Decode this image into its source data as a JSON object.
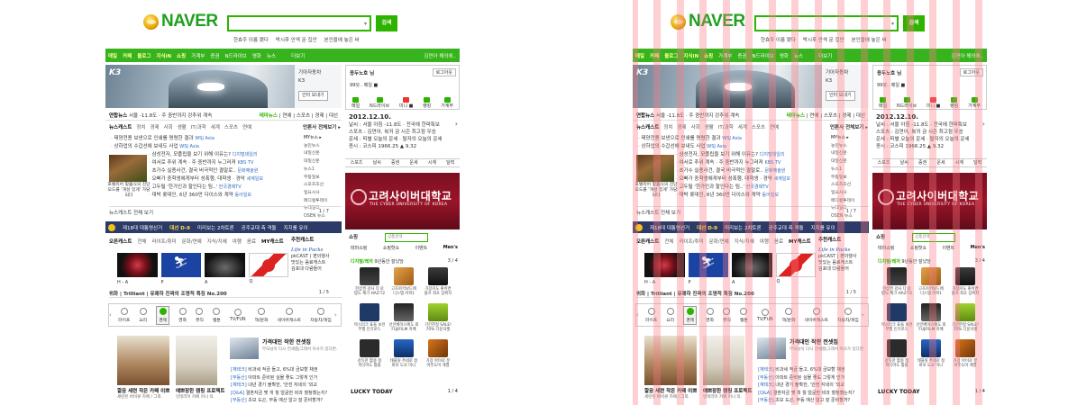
{
  "portal": {
    "logo_text": "NAVER",
    "search": {
      "placeholder": "",
      "button": "검색",
      "dropdown": "▾"
    },
    "hot_keywords": [
      "한효주 이름 됐다",
      "박시후 안색 문 집안",
      "본인을에 놓은 싸"
    ],
    "gnb": {
      "items": [
        "메일",
        "카페",
        "블로그",
        "지식iN",
        "쇼핑",
        "가계부",
        "증권",
        "N드라이브",
        "영화",
        "뉴스"
      ],
      "highlight": [
        "메일",
        "카페",
        "블로그",
        "지식iN",
        "쇼핑"
      ],
      "more": "더보기",
      "right": "김연아 해외에.."
    },
    "banner": {
      "brand": "K3",
      "info_title": "기아자동차",
      "info_sub": "K3",
      "button": "인터 보내기"
    },
    "login": {
      "name": "용두노호 님",
      "logout": "로그아웃",
      "mail": "99닷.. 메일 ■",
      "icons": [
        {
          "label": "메일",
          "count": "",
          "red": false
        },
        {
          "label": "N드라이브",
          "count": "",
          "red": false
        },
        {
          "label": "미니 ■",
          "count": "",
          "red": true
        },
        {
          "label": "랭킹",
          "count": "",
          "red": false
        },
        {
          "label": "가계부",
          "count": "",
          "red": false
        }
      ]
    },
    "breaking": {
      "label": "연합뉴스",
      "text": "서울 -11.8도 · 주 중반까지 강추위 계속",
      "topics": [
        "테마뉴스",
        "연예",
        "스포츠",
        "경제",
        "대선"
      ]
    },
    "date_box": {
      "date": "2012.12.10.",
      "lines": [
        "날씨 : 서울 아침 -11.8도 · 전국에 한파특보",
        "스포츠 : 김연아, 복귀 금 시즌 최고점 우승",
        "운세 : 띠별 오늘의 운세 · 탈자의 오늘의 운세",
        "증시 : 코스피 1966.25 ▲ 9.32"
      ]
    },
    "news_tabs": [
      "뉴스캐스트",
      "정치",
      "경제",
      "사회",
      "생활",
      "IT/과학",
      "세계",
      "스포츠",
      "연예"
    ],
    "news_items": [
      {
        "text": "태양전용 보낸으로 인쇄를 명령한 결과",
        "src": "WSJ Asia"
      },
      {
        "text": "상하업의 수갑선에 보내도 사업",
        "src": "WSJ Asia"
      },
      {
        "text": "삼성전자, 모플립을 보기 위해 이유는?",
        "src": "디지털데일리"
      },
      {
        "text": "여서로 추위 계속 · 주 중반까지 누그러져",
        "src": "KBS TV"
      },
      {
        "text": "초가수 실종사건, 결국 비극적인 결말로..",
        "src": "문화예술원"
      },
      {
        "text": "오빠가 중학생에게부터 성폭행, 대학생 · 경악",
        "src": "세계일보"
      },
      {
        "text": "고두릴 '한가인과 할인다는 팀..'",
        "src": "한국경제TV"
      },
      {
        "text": "대박 롯데인, 6년 360만 다이스와 계약",
        "src": "동아일보"
      }
    ],
    "news_photo_caption": "호텔리어 맞춤식의 진단 모드를 '개성 있게' 가당 되다",
    "press": {
      "label": "언론사 전체보기 ▸",
      "selector": "MY뉴스 ▸",
      "list": [
        "농민뉴스",
        "내일신문",
        "대일신문",
        "뉴스1",
        "무등일보",
        "스포츠조선",
        "일요시사",
        "메디컬투데이",
        "뉴데일리",
        "OSEN 뉴스",
        "WSJ Asia",
        "매일신문"
      ]
    },
    "news_bottom": {
      "label": "뉴스캐스트 전체 보기",
      "page": "1 / 7"
    },
    "weather_tabs": [
      "스포츠",
      "날씨",
      "증권",
      "운세",
      "시계",
      "달력"
    ],
    "ad": {
      "title": "고려사이버대학교",
      "subtitle": "THE CYBER UNIVERSITY OF KOREA"
    },
    "election": {
      "label": "제18대 대통령선거",
      "dday": "대선 D-9",
      "items": [
        "미리보는 2차토론",
        "공주교대 측 격돌",
        "지지를 유이"
      ]
    },
    "cast_tabs": [
      "오픈캐스트",
      "전체",
      "라이프/취미",
      "문화/연예",
      "지식/지혜",
      "여행",
      "음료",
      "MY캐스트"
    ],
    "cast_thumbs": [
      "H - A",
      "P",
      "A",
      "Q"
    ],
    "suggest": {
      "title": "추천캐스트",
      "brand": "Life in Packs",
      "lines": [
        "pkCAST | 편의행사",
        "맛있는 음료캐스트",
        "김포대 다람들어"
      ]
    },
    "cast_title": {
      "text": "위화 | Trilliant | 유쾌하 진짜의 조명적 특징 No.200",
      "page": "1 / 5"
    },
    "shopping": {
      "title": "쇼핑",
      "search_placeholder": "상품검색",
      "tabs": [
        "테마쇼핑",
        "쇼핑핫쇼",
        "이벤트",
        "Men's"
      ],
      "digital_label": "디지털/레저",
      "digital_sub": "9년동안 잘났당",
      "page": "3 / 4",
      "items": [
        {
          "l1": "한상권 강사 다 로",
          "l2": "밥도 체크 HAZ-T2"
        },
        {
          "l1": "고흐카키보드에",
          "l2": "디스템 커피1"
        },
        {
          "l1": "가장커도 좋이면",
          "l2": "블프 최초 상위지"
        },
        {
          "l1": "마스터크 표들 보관",
          "l2": "부행 인기로드"
        },
        {
          "l1": "선인베이스에도 회",
          "l2": "FUJIFILM 카메"
        },
        {
          "l1": "기간한정 SALE!",
          "l2": "70% 다운자켓"
        },
        {
          "l1": "강득한 활용 정",
          "l2": "미디어도 펌블"
        },
        {
          "l1": "태블릿 주네로 정",
          "l2": "바로 도로 미니"
        },
        {
          "l1": "가장 아이로 분",
          "l2": "아웃도어 계열"
        }
      ],
      "lucky": "LUCKY TODAY",
      "lucky_page": "1 / 4"
    },
    "services": [
      {
        "label": "라이프",
        "on": false
      },
      {
        "label": "요리",
        "on": false
      },
      {
        "label": "경제",
        "on": true
      },
      {
        "label": "영화",
        "on": false
      },
      {
        "label": "뮤직",
        "on": false
      },
      {
        "label": "웹툰",
        "on": false
      },
      {
        "label": "TV/FUN",
        "on": false
      },
      {
        "label": "책/문화",
        "on": false
      },
      {
        "label": "네이버캐스트",
        "on": false
      },
      {
        "label": "자동차/게임",
        "on": false
      }
    ],
    "feature": {
      "cap1": "깔끔 세련 작은 카페 이쁘",
      "sub1": "세련된 바비큐 카페 / 그외.",
      "cap2": "예쁘장한 캠핑 프로젝트",
      "sub2": "인테리어 카페 이니 의.",
      "head": "가격대인 작한 전셋집",
      "sub": "부모님이 다시 전세를|그래서 이사가 있다면.",
      "list": [
        {
          "c": "[재테크]",
          "t": "비과세 적금 들고, 6%대 금보할 채권"
        },
        {
          "c": "[부동산]",
          "t": "아파트 준비된 실물 좋도 그렇게 인가"
        },
        {
          "c": "[재테크]",
          "t": "내년 경기 불확한, '안전 자네의 '외교"
        },
        {
          "c": "[Q&A]",
          "t": "결혼자금 몇 개 월 얼굴한 비과 혈청했는지?"
        },
        {
          "c": "[부동산]",
          "t": "초보 도곤, 부동 예산 알고 잘 준비할까?"
        }
      ]
    }
  }
}
